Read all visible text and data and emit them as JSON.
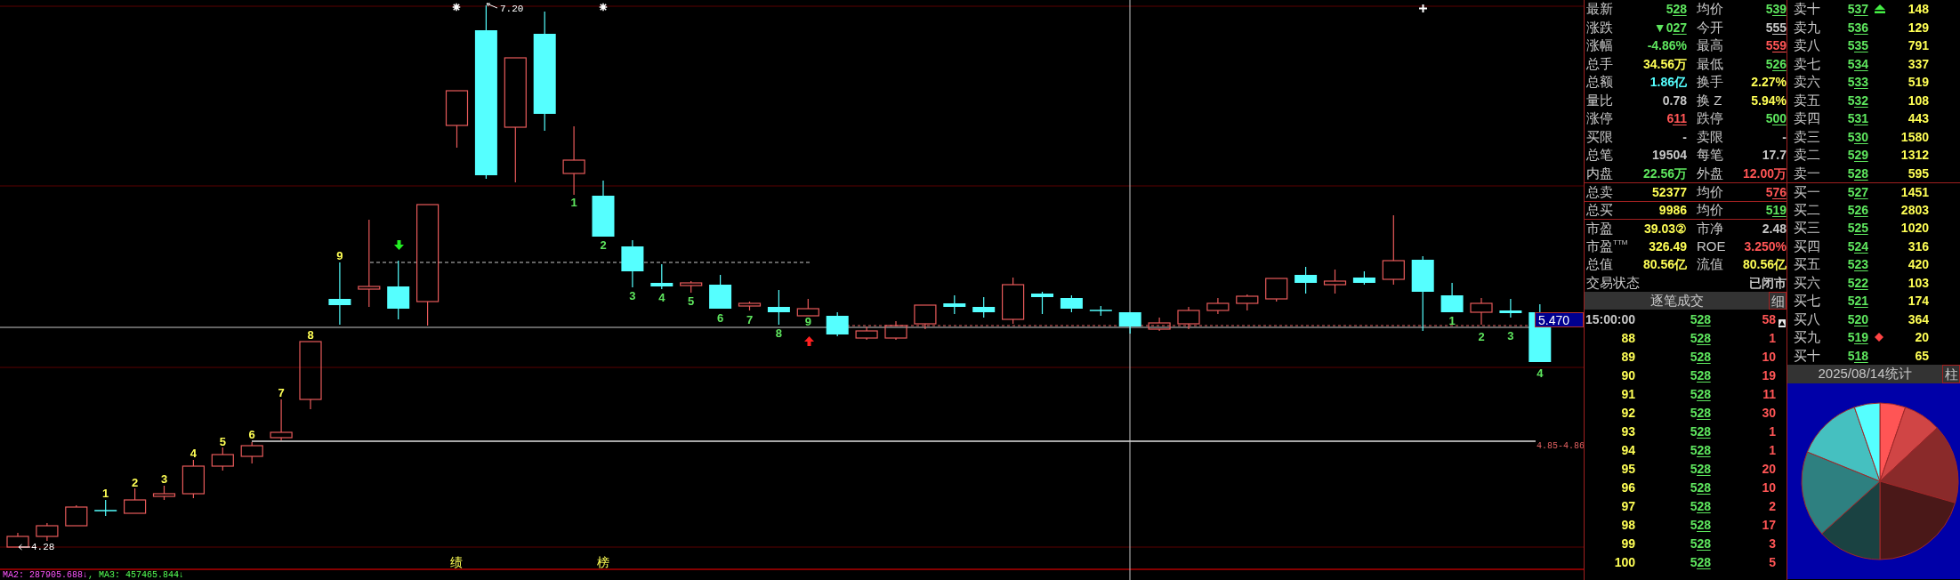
{
  "chart": {
    "high_label": "7.20",
    "low_label": "4.28",
    "price_tag": "5.470",
    "range_label": "4.85-4.86",
    "sequence_labels": [
      {
        "text": "1",
        "color": "#ffff55"
      },
      {
        "text": "2",
        "color": "#ffff55"
      },
      {
        "text": "3",
        "color": "#ffff55"
      },
      {
        "text": "4",
        "color": "#ffff55"
      },
      {
        "text": "5",
        "color": "#ffff55"
      },
      {
        "text": "6",
        "color": "#ffff55"
      },
      {
        "text": "7",
        "color": "#ffff55"
      },
      {
        "text": "8",
        "color": "#ffff55"
      },
      {
        "text": "9",
        "color": "#ffff55"
      },
      {
        "text": "1",
        "color": "#5ee65e"
      },
      {
        "text": "2",
        "color": "#5ee65e"
      },
      {
        "text": "3",
        "color": "#5ee65e"
      },
      {
        "text": "4",
        "color": "#5ee65e"
      },
      {
        "text": "5",
        "color": "#5ee65e"
      },
      {
        "text": "6",
        "color": "#5ee65e"
      },
      {
        "text": "7",
        "color": "#5ee65e"
      },
      {
        "text": "8",
        "color": "#5ee65e"
      },
      {
        "text": "9",
        "color": "#5ee65e"
      },
      {
        "text": "1",
        "color": "#5ee65e"
      },
      {
        "text": "2",
        "color": "#5ee65e"
      },
      {
        "text": "3",
        "color": "#5ee65e"
      },
      {
        "text": "4",
        "color": "#5ee65e"
      }
    ],
    "event_marks": [
      {
        "text": "绩"
      },
      {
        "text": "榜"
      }
    ],
    "legend": [
      {
        "text": "MA2: 287905.688↓",
        "color": "#ff55ff"
      },
      {
        "text": ", MA3: 457465.844↓",
        "color": "#55ff55"
      }
    ]
  },
  "quote": {
    "sections": [
      {
        "rows": [
          {
            "cells": [
              {
                "label": "最新",
                "value": "528",
                "kind": "price",
                "color": "#5ee65e"
              },
              {
                "label": "均价",
                "value": "539",
                "kind": "price",
                "color": "#5ee65e"
              }
            ]
          },
          {
            "cells": [
              {
                "label": "涨跌",
                "value": "▼027",
                "kind": "price",
                "color": "#5ee65e"
              },
              {
                "label": "今开",
                "value": "555",
                "kind": "price",
                "color": "#c8c8c8"
              }
            ]
          },
          {
            "cells": [
              {
                "label": "涨幅",
                "value": "-4.86%",
                "kind": "plain",
                "color": "#5ee65e"
              },
              {
                "label": "最高",
                "value": "559",
                "kind": "price",
                "color": "#ff5555"
              }
            ]
          },
          {
            "cells": [
              {
                "label": "总手",
                "value": "34.56万",
                "kind": "plain",
                "color": "#ffff55"
              },
              {
                "label": "最低",
                "value": "526",
                "kind": "price",
                "color": "#5ee65e"
              }
            ]
          },
          {
            "cells": [
              {
                "label": "总额",
                "value": "1.86亿",
                "kind": "plain",
                "color": "#55ffff"
              },
              {
                "label": "换手",
                "value": "2.27%",
                "kind": "plain",
                "color": "#ffff55"
              }
            ]
          },
          {
            "cells": [
              {
                "label": "量比",
                "value": "0.78",
                "kind": "plain",
                "color": "#c8c8c8"
              },
              {
                "label": "换 Z",
                "value": "5.94%",
                "kind": "plain",
                "color": "#ffff55"
              }
            ]
          },
          {
            "cells": [
              {
                "label": "涨停",
                "value": "611",
                "kind": "price",
                "color": "#ff5555"
              },
              {
                "label": "跌停",
                "value": "500",
                "kind": "price",
                "color": "#5ee65e"
              }
            ]
          },
          {
            "cells": [
              {
                "label": "买限",
                "value": "-",
                "kind": "plain",
                "color": "#c8c8c8"
              },
              {
                "label": "卖限",
                "value": "-",
                "kind": "plain",
                "color": "#c8c8c8"
              }
            ]
          },
          {
            "cells": [
              {
                "label": "总笔",
                "value": "19504",
                "kind": "plain",
                "color": "#c8c8c8"
              },
              {
                "label": "每笔",
                "value": "17.7",
                "kind": "plain",
                "color": "#c8c8c8"
              }
            ]
          },
          {
            "cells": [
              {
                "label": "内盘",
                "value": "22.56万",
                "kind": "plain",
                "color": "#5ee65e"
              },
              {
                "label": "外盘",
                "value": "12.00万",
                "kind": "plain",
                "color": "#ff5555"
              }
            ]
          }
        ]
      },
      {
        "rows": [
          {
            "cells": [
              {
                "label": "总卖",
                "value": "52377",
                "kind": "plain",
                "color": "#ffff55"
              },
              {
                "label": "均价",
                "value": "576",
                "kind": "price",
                "color": "#ff5555"
              }
            ]
          }
        ]
      },
      {
        "rows": [
          {
            "cells": [
              {
                "label": "总买",
                "value": "9986",
                "kind": "plain",
                "color": "#ffff55"
              },
              {
                "label": "均价",
                "value": "519",
                "kind": "price",
                "color": "#5ee65e"
              }
            ]
          }
        ]
      },
      {
        "rows": [
          {
            "cells": [
              {
                "label": "市盈",
                "value": "39.03②",
                "kind": "plain",
                "color": "#ffff55"
              },
              {
                "label": "市净",
                "value": "2.48",
                "kind": "plain",
                "color": "#c8c8c8"
              }
            ]
          },
          {
            "cells": [
              {
                "label": "市盈$^{TTM}$",
                "value": "326.49",
                "kind": "plain",
                "color": "#ffff55"
              },
              {
                "label": "ROE",
                "value": "3.250%",
                "kind": "plain",
                "color": "#ff5555"
              }
            ]
          },
          {
            "cells": [
              {
                "label": "总值",
                "value": "80.56亿",
                "kind": "plain",
                "color": "#ffff55"
              },
              {
                "label": "流值",
                "value": "80.56亿",
                "kind": "plain",
                "color": "#ffff55"
              }
            ]
          },
          {
            "cells": [
              {
                "label": "交易状态",
                "value": "已闭市",
                "kind": "plain",
                "color": "#c8c8c8"
              }
            ]
          }
        ]
      }
    ]
  },
  "order_book": {
    "asks": [
      {
        "kind": "arrow",
        "label": "卖十",
        "price": "537",
        "volume": "148"
      },
      {
        "kind": "plain",
        "label": "卖九",
        "price": "536",
        "volume": "129"
      },
      {
        "kind": "plain",
        "label": "卖八",
        "price": "535",
        "volume": "791"
      },
      {
        "kind": "plain",
        "label": "卖七",
        "price": "534",
        "volume": "337"
      },
      {
        "kind": "plain",
        "label": "卖六",
        "price": "533",
        "volume": "519"
      },
      {
        "kind": "plain",
        "label": "卖五",
        "price": "532",
        "volume": "108"
      },
      {
        "kind": "plain",
        "label": "卖四",
        "price": "531",
        "volume": "443"
      },
      {
        "kind": "plain",
        "label": "卖三",
        "price": "530",
        "volume": "1580"
      },
      {
        "kind": "plain",
        "label": "卖二",
        "price": "529",
        "volume": "1312"
      },
      {
        "kind": "plain",
        "label": "卖一",
        "price": "528",
        "volume": "595"
      }
    ],
    "bids": [
      {
        "kind": "plain",
        "label": "买一",
        "price": "527",
        "volume": "1451"
      },
      {
        "kind": "plain",
        "label": "买二",
        "price": "526",
        "volume": "2803"
      },
      {
        "kind": "plain",
        "label": "买三",
        "price": "525",
        "volume": "1020"
      },
      {
        "kind": "plain",
        "label": "买四",
        "price": "524",
        "volume": "316"
      },
      {
        "kind": "plain",
        "label": "买五",
        "price": "523",
        "volume": "420"
      },
      {
        "kind": "plain",
        "label": "买六",
        "price": "522",
        "volume": "103"
      },
      {
        "kind": "plain",
        "label": "买七",
        "price": "521",
        "volume": "174"
      },
      {
        "kind": "plain",
        "label": "买八",
        "price": "520",
        "volume": "364"
      },
      {
        "kind": "diamond",
        "label": "买九",
        "price": "519",
        "volume": "20"
      },
      {
        "kind": "plain",
        "label": "买十",
        "price": "518",
        "volume": "65"
      }
    ]
  },
  "trades": {
    "title": "逐笔成交",
    "button": "细",
    "rows": [
      {
        "kind": "clock",
        "time": "15:00:00",
        "price": "528",
        "volume": "58"
      },
      {
        "kind": "tick",
        "time": "88",
        "price": "528",
        "volume": "1"
      },
      {
        "kind": "tick",
        "time": "89",
        "price": "528",
        "volume": "10"
      },
      {
        "kind": "tick",
        "time": "90",
        "price": "528",
        "volume": "19"
      },
      {
        "kind": "tick",
        "time": "91",
        "price": "528",
        "volume": "11"
      },
      {
        "kind": "tick",
        "time": "92",
        "price": "528",
        "volume": "30"
      },
      {
        "kind": "tick",
        "time": "93",
        "price": "528",
        "volume": "1"
      },
      {
        "kind": "tick",
        "time": "94",
        "price": "528",
        "volume": "1"
      },
      {
        "kind": "tick",
        "time": "95",
        "price": "528",
        "volume": "20"
      },
      {
        "kind": "tick",
        "time": "96",
        "price": "528",
        "volume": "10"
      },
      {
        "kind": "tick",
        "time": "97",
        "price": "528",
        "volume": "2"
      },
      {
        "kind": "tick",
        "time": "98",
        "price": "528",
        "volume": "17"
      },
      {
        "kind": "tick",
        "time": "99",
        "price": "528",
        "volume": "3"
      },
      {
        "kind": "tick",
        "time": "100",
        "price": "528",
        "volume": "5"
      }
    ]
  },
  "distribution": {
    "title": "2025/08/14统计",
    "button": "柱"
  }
}
